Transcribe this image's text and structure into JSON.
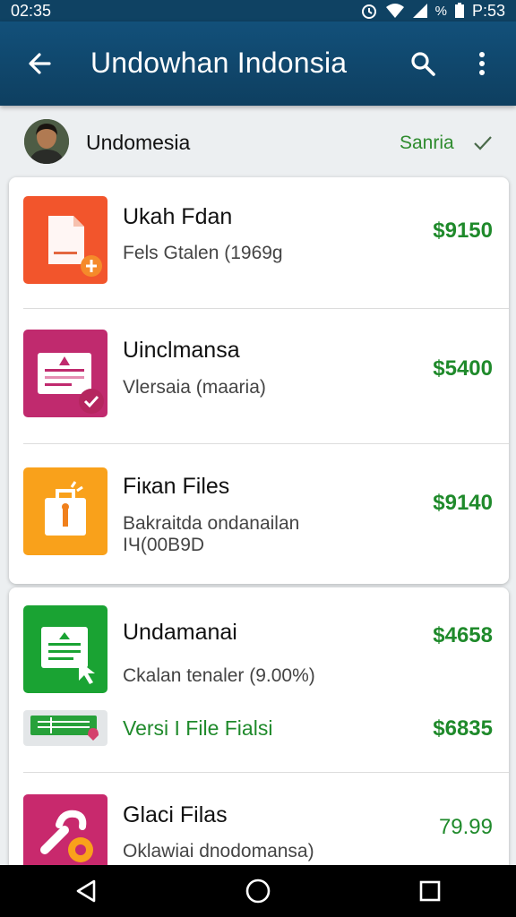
{
  "status_bar": {
    "time": "02:35",
    "right_time": "P:53"
  },
  "app_bar": {
    "title": "Undowhan Indonsia"
  },
  "account": {
    "name": "Undomesia",
    "status": "Sanria"
  },
  "items": [
    {
      "name": "Ukah Fdan",
      "sub": "Fels Gtalen (1969g",
      "price": "$9150",
      "color": "#f2552c",
      "icon": "document-icon"
    },
    {
      "name": "Uinclmansa",
      "sub": "Vlersaia (maaria)",
      "price": "$5400",
      "color": "#c02a6e",
      "icon": "form-icon"
    },
    {
      "name": "Fiкan Files",
      "sub": "Bakraitda ondanailan\nIЧ(00B9D",
      "price": "$9140",
      "color": "#f9a11b",
      "icon": "bag-icon"
    },
    {
      "name": "Undamanai",
      "sub": "Ckalan tenaler (9.00%)",
      "price": "$4658",
      "color": "#1aa333",
      "icon": "sheet-icon"
    },
    {
      "name": "Versi I File Fialsi",
      "price": "$6835",
      "color": "#27a13a",
      "icon": "banner-icon"
    },
    {
      "name": "Glaci Filas",
      "sub": "Oklawiai dnodomansa)",
      "price": "79.99",
      "color": "#c8296d",
      "icon": "wrench-icon"
    }
  ],
  "colors": {
    "app_bar": "#0f4263",
    "price_green": "#1f8a2b",
    "status_green": "#2e8b2e"
  }
}
